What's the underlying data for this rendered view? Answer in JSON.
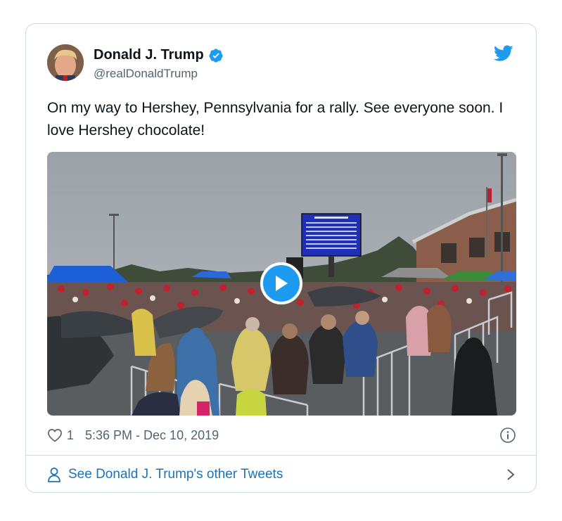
{
  "tweet": {
    "author_name": "Donald J. Trump",
    "author_handle": "@realDonaldTrump",
    "text": "On my way to Hershey, Pennsylvania for a rally. See everyone soon. I love Hershey chocolate!",
    "like_count": "1",
    "timestamp": "5:36 PM - Dec 10, 2019"
  },
  "footer": {
    "link_text": "See Donald J. Trump's other Tweets"
  },
  "icons": {
    "verified": "verified-badge-icon",
    "brand": "twitter-bird-icon",
    "like": "heart-icon",
    "info": "info-icon",
    "profile": "person-icon",
    "chevron": "chevron-right-icon",
    "play": "play-icon"
  },
  "colors": {
    "accent": "#1d9bf0",
    "link": "#1d73b9",
    "text": "#0f1419",
    "secondary": "#536471",
    "border": "#cfd9de"
  }
}
